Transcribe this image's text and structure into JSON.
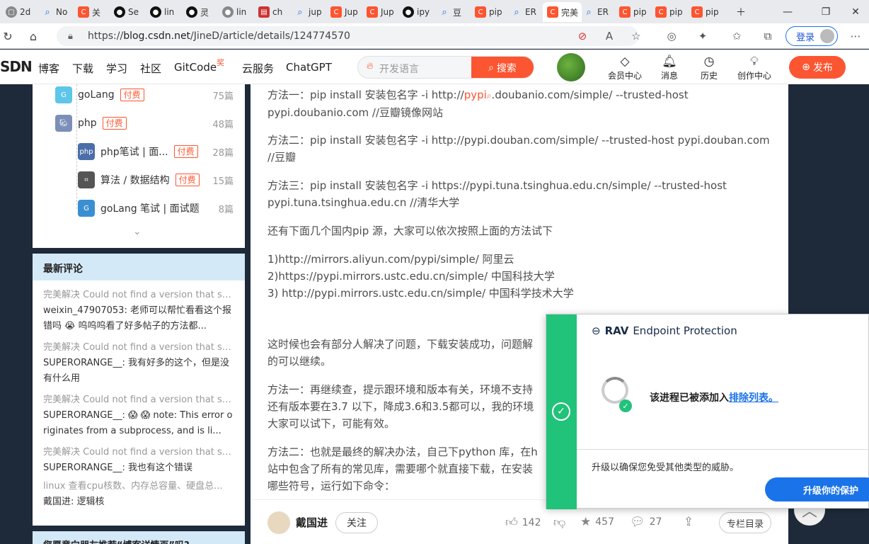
{
  "tabs": [
    {
      "label": "2d",
      "icon": "app"
    },
    {
      "label": "No",
      "icon": "search"
    },
    {
      "label": "关",
      "icon": "csdn"
    },
    {
      "label": "Se",
      "icon": "github"
    },
    {
      "label": "lin",
      "icon": "github"
    },
    {
      "label": "灵",
      "icon": "github"
    },
    {
      "label": "lin",
      "icon": "github-gray"
    },
    {
      "label": "ch",
      "icon": "doc"
    },
    {
      "label": "jup",
      "icon": "search"
    },
    {
      "label": "Jup",
      "icon": "csdn"
    },
    {
      "label": "Jup",
      "icon": "csdn"
    },
    {
      "label": "ipy",
      "icon": "github"
    },
    {
      "label": "豆",
      "icon": "search"
    },
    {
      "label": "pip",
      "icon": "csdn"
    },
    {
      "label": "ER",
      "icon": "search"
    },
    {
      "label": "完美",
      "icon": "csdn"
    },
    {
      "label": "ER",
      "icon": "search"
    },
    {
      "label": "pip",
      "icon": "csdn"
    },
    {
      "label": "pip",
      "icon": "csdn"
    },
    {
      "label": "pip",
      "icon": "csdn"
    }
  ],
  "url": {
    "prefix": "https://",
    "host": "blog.csdn.net",
    "path": "/JineD/article/details/124774570"
  },
  "login_label": "登录",
  "csdn": {
    "logo": "SDN",
    "nav": [
      "博客",
      "下载",
      "学习",
      "社区",
      "GitCode",
      "云服务",
      "ChatGPT"
    ],
    "hot_badge": "奖",
    "search_placeholder": "开发语言",
    "search_button": "搜索",
    "icons": [
      {
        "label": "会员中心"
      },
      {
        "label": "消息"
      },
      {
        "label": "历史"
      },
      {
        "label": "创作中心"
      }
    ],
    "publish": "发布"
  },
  "categories": [
    {
      "name": "goLang",
      "paid": "付费",
      "count": "75篇",
      "icon": "gopher-icon"
    },
    {
      "name": "php",
      "paid": "付费",
      "count": "48篇",
      "icon": "elephant-icon"
    },
    {
      "name": "php笔试 | 面...",
      "paid": "付费",
      "count": "28篇",
      "icon": "php-icon"
    },
    {
      "name": "算法 / 数据结构",
      "paid": "付费",
      "count": "15篇",
      "icon": "graph-icon"
    },
    {
      "name": "goLang 笔试 | 面试题",
      "paid": "",
      "count": "8篇",
      "icon": "gopher-icon"
    }
  ],
  "comments": {
    "title": "最新评论",
    "items": [
      {
        "title": "完美解决 Could not find a version that sa...",
        "body": "weixin_47907053: 老师可以帮忙看看这个报错吗 😭 呜呜呜看了好多帖子的方法都..."
      },
      {
        "title": "完美解决 Could not find a version that sa...",
        "body": "SUPERORANGE__: 我有好多的这个，但是没有什么用"
      },
      {
        "title": "完美解决 Could not find a version that sa...",
        "body": "SUPERORANGE__: 😱 😱 note: This error originates from a subprocess, and is li..."
      },
      {
        "title": "完美解决 Could not find a version that sa...",
        "body": "SUPERORANGE__: 我也有这个错误"
      },
      {
        "title": "linux 查看cpu核数、内存总容量、硬盘总...",
        "body": "戴国进: 逻辑核"
      }
    ],
    "next_title": "您愿意向朋友推荐“博客详情页”吗?"
  },
  "article": {
    "p1a": "方法一：pip install 安装包名字 -i http://",
    "p1link": "pypi",
    "p1b": ".doubanio.com/simple/ --trusted-host pypi.doubanio.com //豆瓣镜像网站",
    "p2": "方法二：pip install 安装包名字 -i http://pypi.douban.com/simple/ --trusted-host pypi.douban.com //豆瓣",
    "p3": "方法三：pip install 安装包名字 -i https://pypi.tuna.tsinghua.edu.cn/simple/ --trusted-host pypi.tuna.tsinghua.edu.cn //清华大学",
    "p4": "还有下面几个国内pip 源，大家可以依次按照上面的方法试下",
    "mirror1": "1)http://mirrors.aliyun.com/pypi/simple/ 阿里云",
    "mirror2": "2)https://pypi.mirrors.ustc.edu.cn/simple/ 中国科技大学",
    "mirror3": "3) http://pypi.mirrors.ustc.edu.cn/simple/ 中国科学技术大学",
    "p5": "这时候也会有部分人解决了问题，下载安装成功，问题解",
    "p5b": "的可以继续。",
    "p6a": "方法一：再继续查，提示跟环境和版本有关，环境不支持",
    "p6b": "还有版本要在3.7 以下，降成3.6和3.5都可以，我的环境",
    "p6c": "大家可以试下，可能有效。",
    "p7a": "方法二：也就是最终的解决办法，自己下python 库，在h",
    "p7b": "站中包含了所有的常见库，需要哪个就直接下载，在安装",
    "p7c": "哪些符号，运行如下命令："
  },
  "author": {
    "name": "戴国进",
    "follow": "关注"
  },
  "actions": {
    "likes": "142",
    "stars": "457",
    "comments": "27",
    "toc": "专栏目录"
  },
  "rav": {
    "brand_bold": "RAV",
    "brand_rest": "Endpoint Protection",
    "msg": "该进程已被添加入",
    "msg_link": "排除列表。",
    "upsell": "升级以确保您免受其他类型的威胁。",
    "upgrade": "升级你的保护"
  }
}
